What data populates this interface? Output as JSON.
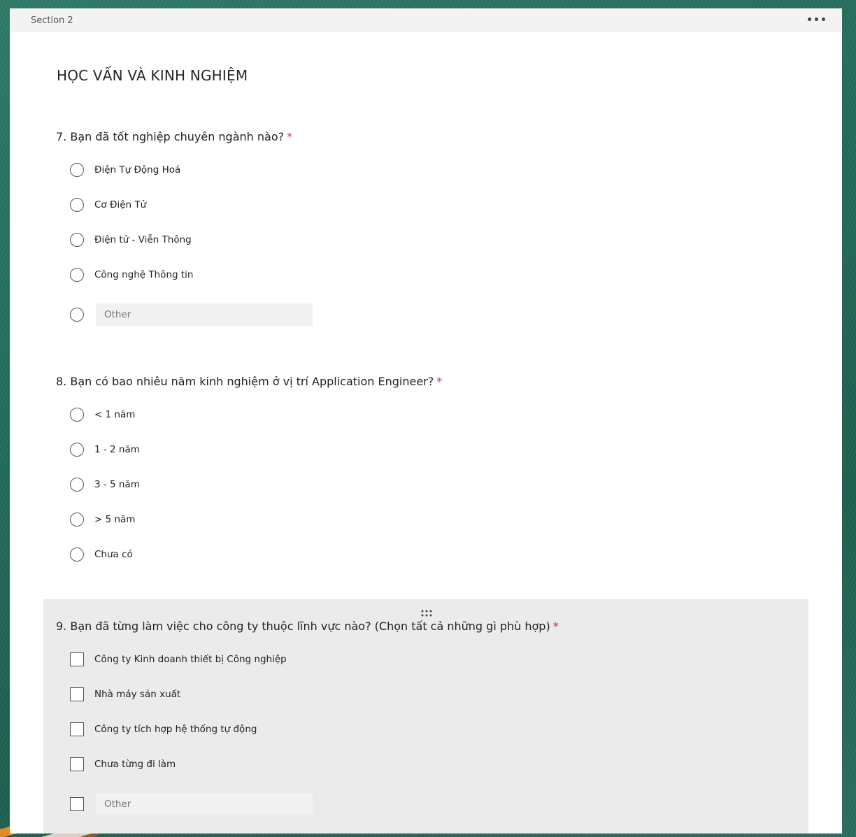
{
  "section": {
    "label": "Section 2",
    "more_label": "•••",
    "title": "HỌC VẤN VÀ KINH NGHIỆM"
  },
  "questions": [
    {
      "title": "7. Bạn đã tốt nghiệp chuyên ngành nào?",
      "required_mark": "*",
      "type": "radio",
      "options": [
        "Điện Tự Động Hoá",
        "Cơ Điện Tử",
        "Điện tử - Viễn Thông",
        "Công nghệ Thông tin"
      ],
      "other_placeholder": "Other"
    },
    {
      "title": "8. Bạn có bao nhiêu năm kinh nghiệm ở vị trí Application Engineer?",
      "required_mark": "*",
      "type": "radio",
      "options": [
        "< 1 năm",
        "1 - 2 năm",
        "3 - 5 năm",
        "> 5 năm",
        "Chưa có"
      ]
    },
    {
      "title": "9. Bạn đã từng làm việc cho công ty thuộc lĩnh vực nào? (Chọn tất cả những gì phù hợp)",
      "required_mark": "*",
      "type": "checkbox",
      "options": [
        "Công ty Kinh doanh thiết bị Công nghiệp",
        "Nhà máy sản xuất",
        "Công ty tích hợp hệ thống tự động",
        "Chưa từng đi làm"
      ],
      "other_placeholder": "Other"
    }
  ],
  "icons": {
    "more": "more-horizontal-icon",
    "drag": "drag-handle-icon"
  }
}
